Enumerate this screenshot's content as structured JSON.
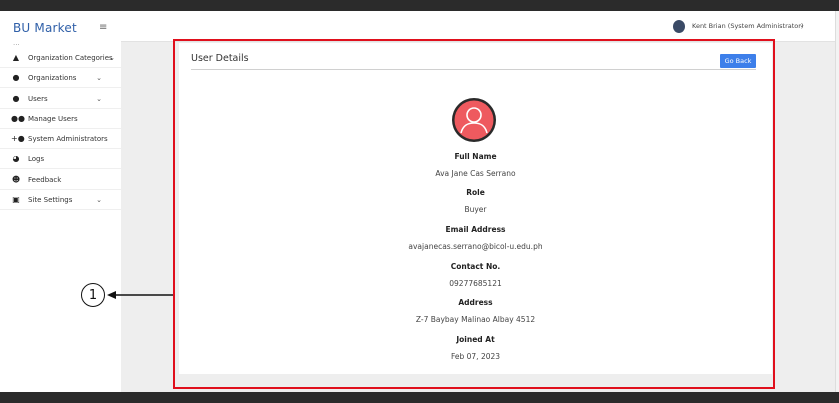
{
  "app": {
    "brand": "BU Market",
    "sidebar_mark": "..."
  },
  "sidebar": {
    "items": [
      {
        "label": "Organization Categories",
        "icon": "shirt-icon",
        "has_chevron": true
      },
      {
        "label": "Organizations",
        "icon": "person-icon",
        "has_chevron": true
      },
      {
        "label": "Users",
        "icon": "person-icon",
        "has_chevron": true
      },
      {
        "label": "Manage Users",
        "icon": "people-icon",
        "has_chevron": false
      },
      {
        "label": "System Administrators",
        "icon": "add-user-icon",
        "has_chevron": false
      },
      {
        "label": "Logs",
        "icon": "pie-chart-icon",
        "has_chevron": false
      },
      {
        "label": "Feedback",
        "icon": "smile-icon",
        "has_chevron": false
      },
      {
        "label": "Site Settings",
        "icon": "window-icon",
        "has_chevron": true
      }
    ]
  },
  "header": {
    "user": "Kent Brian (System Administrator)"
  },
  "card": {
    "title": "User Details",
    "go_back": "Go Back",
    "fields": [
      {
        "label": "Full Name",
        "value": "Ava Jane Cas Serrano"
      },
      {
        "label": "Role",
        "value": "Buyer"
      },
      {
        "label": "Email Address",
        "value": "avajanecas.serrano@bicol-u.edu.ph"
      },
      {
        "label": "Contact No.",
        "value": "09277685121"
      },
      {
        "label": "Address",
        "value": "Z-7 Baybay Malinao Albay 4512"
      },
      {
        "label": "Joined At",
        "value": "Feb 07, 2023"
      }
    ]
  },
  "annotation": {
    "number": "1",
    "color": "#e00f1c"
  }
}
